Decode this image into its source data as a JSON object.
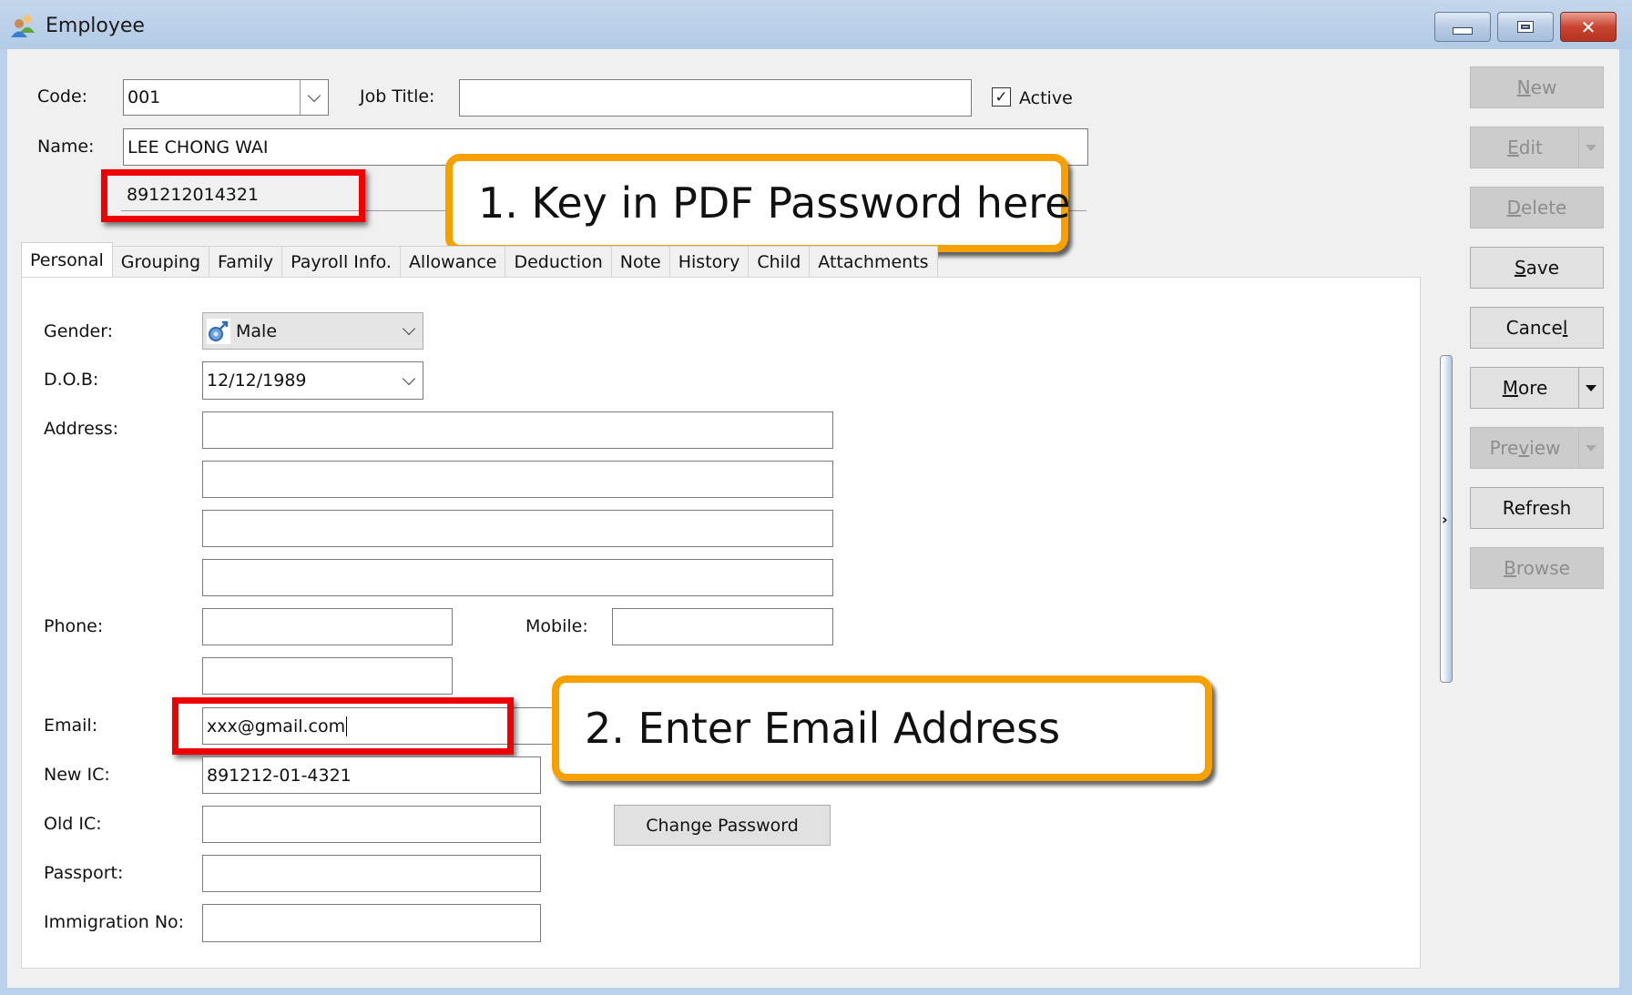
{
  "window": {
    "title": "Employee",
    "icon": "people-icon",
    "controls": {
      "minimize": "minimize-icon",
      "maximize": "maximize-icon",
      "close": "✕"
    }
  },
  "header": {
    "code_label": "Code:",
    "code_value": "001",
    "job_title_label": "Job Title:",
    "job_title_value": "",
    "active_label": "Active",
    "active_checked": "✓",
    "name_label": "Name:",
    "name_value": "LEE CHONG WAI",
    "pdf_password_value": "891212014321"
  },
  "annotations": {
    "callout_1": "1. Key in PDF Password here",
    "callout_2": "2. Enter Email Address",
    "highlight_color": "#ee0000",
    "callout_border_color": "#f7a100"
  },
  "tabs": [
    {
      "label": "Personal",
      "active": true
    },
    {
      "label": "Grouping"
    },
    {
      "label": "Family"
    },
    {
      "label": "Payroll Info."
    },
    {
      "label": "Allowance"
    },
    {
      "label": "Deduction"
    },
    {
      "label": "Note"
    },
    {
      "label": "History"
    },
    {
      "label": "Child"
    },
    {
      "label": "Attachments"
    }
  ],
  "personal": {
    "gender_label": "Gender:",
    "gender_value": "Male",
    "dob_label": "D.O.B:",
    "dob_value": "12/12/1989",
    "address_label": "Address:",
    "address_lines": [
      "",
      "",
      "",
      ""
    ],
    "phone_label": "Phone:",
    "phone_value": "",
    "phone2_value": "",
    "mobile_label": "Mobile:",
    "mobile_value": "",
    "email_label": "Email:",
    "email_value": "xxx@gmail.com",
    "new_ic_label": "New IC:",
    "new_ic_value": "891212-01-4321",
    "old_ic_label": "Old IC:",
    "old_ic_value": "",
    "passport_label": "Passport:",
    "passport_value": "",
    "immigration_label": "Immigration No:",
    "immigration_value": "",
    "change_password_label": "Change Password"
  },
  "side_buttons": {
    "new": {
      "pre": "",
      "u": "N",
      "post": "ew",
      "enabled": false
    },
    "edit": {
      "pre": "",
      "u": "E",
      "post": "dit",
      "enabled": false
    },
    "delete": {
      "pre": "",
      "u": "D",
      "post": "elete",
      "enabled": false
    },
    "save": {
      "pre": "",
      "u": "S",
      "post": "ave",
      "enabled": true
    },
    "cancel": {
      "pre": "Cance",
      "u": "l",
      "post": "",
      "enabled": true
    },
    "more": {
      "pre": "",
      "u": "M",
      "post": "ore",
      "enabled": true
    },
    "preview": {
      "pre": "Pre",
      "u": "v",
      "post": "iew",
      "enabled": false
    },
    "refresh": {
      "pre": "Refresh",
      "u": "",
      "post": "",
      "enabled": true
    },
    "browse": {
      "pre": "",
      "u": "B",
      "post": "rowse",
      "enabled": false
    }
  }
}
